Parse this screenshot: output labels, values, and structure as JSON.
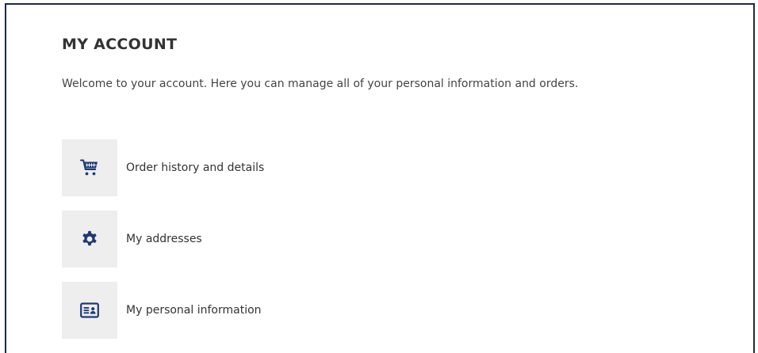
{
  "page": {
    "title": "MY ACCOUNT",
    "welcome": "Welcome to your account. Here you can manage all of your personal information and orders."
  },
  "links": [
    {
      "label": "Order history and details",
      "icon": "cart-icon"
    },
    {
      "label": "My addresses",
      "icon": "gear-icon"
    },
    {
      "label": "My personal information",
      "icon": "id-card-icon"
    }
  ],
  "colors": {
    "icon": "#1e3a72",
    "icon_bg": "#eeeeee",
    "border": "#1b2a4a",
    "text": "#333333"
  }
}
